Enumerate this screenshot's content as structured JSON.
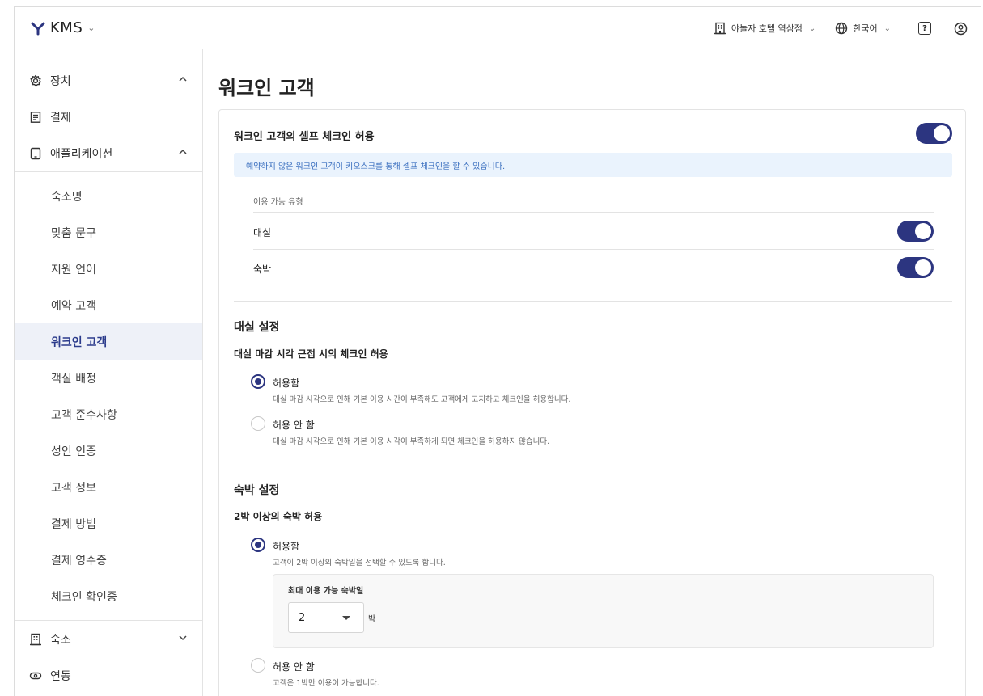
{
  "header": {
    "brand": "KMS",
    "property": "야놀자 호텔 역삼점",
    "language": "한국어"
  },
  "sidebar": {
    "groups": [
      {
        "label": "장치",
        "icon": "gear-icon",
        "expanded": true
      },
      {
        "label": "결제",
        "icon": "receipt-icon"
      },
      {
        "label": "애플리케이션",
        "icon": "tablet-icon",
        "expanded": true
      },
      {
        "label": "숙소",
        "icon": "building-icon",
        "expanded": false
      },
      {
        "label": "연동",
        "icon": "link-icon"
      }
    ],
    "app_items": [
      "숙소명",
      "맞춤 문구",
      "지원 언어",
      "예약 고객",
      "워크인 고객",
      "객실 배정",
      "고객 준수사항",
      "성인 인증",
      "고객 정보",
      "결제 방법",
      "결제 영수증",
      "체크인 확인증"
    ],
    "active_item": "워크인 고객"
  },
  "main": {
    "title": "워크인 고객",
    "self_checkin": {
      "label": "워크인 고객의 셀프 체크인 허용",
      "enabled": true,
      "info": "예약하지 않은 워크인 고객이 키오스크를 통해 셀프 체크인을 할 수 있습니다.",
      "usage_label": "이용 가능 유형",
      "types": [
        {
          "label": "대실",
          "enabled": true
        },
        {
          "label": "숙박",
          "enabled": true
        }
      ]
    },
    "daesil": {
      "heading": "대실 설정",
      "subheading": "대실 마감 시각 근접 시의 체크인 허용",
      "options": [
        {
          "label": "허용함",
          "desc": "대실 마감 시각으로 인해 기본 이용 시간이 부족해도 고객에게 고지하고 체크인을 허용합니다.",
          "selected": true
        },
        {
          "label": "허용 안 함",
          "desc": "대실 마감 시각으로 인해 기본 이용 시각이 부족하게 되면 체크인을 허용하지 않습니다.",
          "selected": false
        }
      ]
    },
    "sukbak": {
      "heading": "숙박 설정",
      "subheading": "2박 이상의 숙박 허용",
      "options": [
        {
          "label": "허용함",
          "desc": "고객이 2박 이상의 숙박일을 선택할 수 있도록 합니다.",
          "selected": true
        },
        {
          "label": "허용 안 함",
          "desc": "고객은 1박만 이용이 가능합니다.",
          "selected": false
        }
      ],
      "max_nights_label": "최대 이용 가능 숙박일",
      "max_nights_value": "2",
      "max_nights_unit": "박"
    }
  },
  "colors": {
    "accent": "#2c3580",
    "active_bg": "#eef1f8",
    "info_bg": "#eaf3fd",
    "info_text": "#3a6fbf"
  }
}
